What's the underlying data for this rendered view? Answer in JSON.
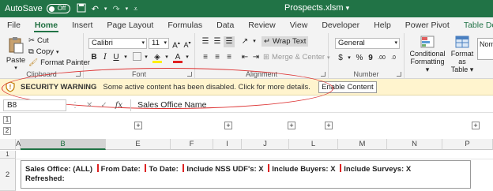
{
  "titlebar": {
    "autosave_label": "AutoSave",
    "autosave_state": "Off",
    "filename": "Prospects.xlsm",
    "title_caret": "▾"
  },
  "tabs": [
    "File",
    "Home",
    "Insert",
    "Page Layout",
    "Formulas",
    "Data",
    "Review",
    "View",
    "Developer",
    "Help",
    "Power Pivot",
    "Table Design"
  ],
  "active_tab": "Home",
  "ribbon": {
    "clipboard": {
      "paste": "Paste",
      "cut": "Cut",
      "copy": "Copy",
      "format_painter": "Format Painter",
      "label": "Clipboard"
    },
    "font": {
      "family": "Calibri",
      "size": "11",
      "label": "Font"
    },
    "alignment": {
      "wrap_text": "Wrap Text",
      "merge_center": "Merge & Center",
      "label": "Alignment"
    },
    "number": {
      "format": "General",
      "label": "Number"
    },
    "styles": {
      "conditional": "Conditional",
      "conditional2": "Formatting",
      "format_as": "Format as",
      "table": "Table",
      "style_box": "Norm"
    }
  },
  "security": {
    "title": "SECURITY WARNING",
    "message": "Some active content has been disabled. Click for more details.",
    "button": "Enable Content"
  },
  "formula_bar": {
    "name_box": "B8",
    "content": "Sales Office Name"
  },
  "grid": {
    "levels": [
      "1",
      "2"
    ],
    "columns": [
      "A",
      "B",
      "E",
      "F",
      "I",
      "J",
      "L",
      "M",
      "N",
      "P"
    ],
    "selected_column": "B",
    "rows": [
      "1",
      "2"
    ],
    "row2_text": {
      "sales_office": "Sales Office: (ALL)",
      "from_date": "From Date:",
      "to_date": "To Date:",
      "nss": "Include NSS UDF's: X",
      "buyers": "Include Buyers: X",
      "surveys": "Include Surveys: X",
      "refreshed": "Refreshed:"
    }
  },
  "colors": {
    "excel_green": "#217346",
    "warning_bg": "#fff4ce",
    "annotation": "#dd3333"
  }
}
